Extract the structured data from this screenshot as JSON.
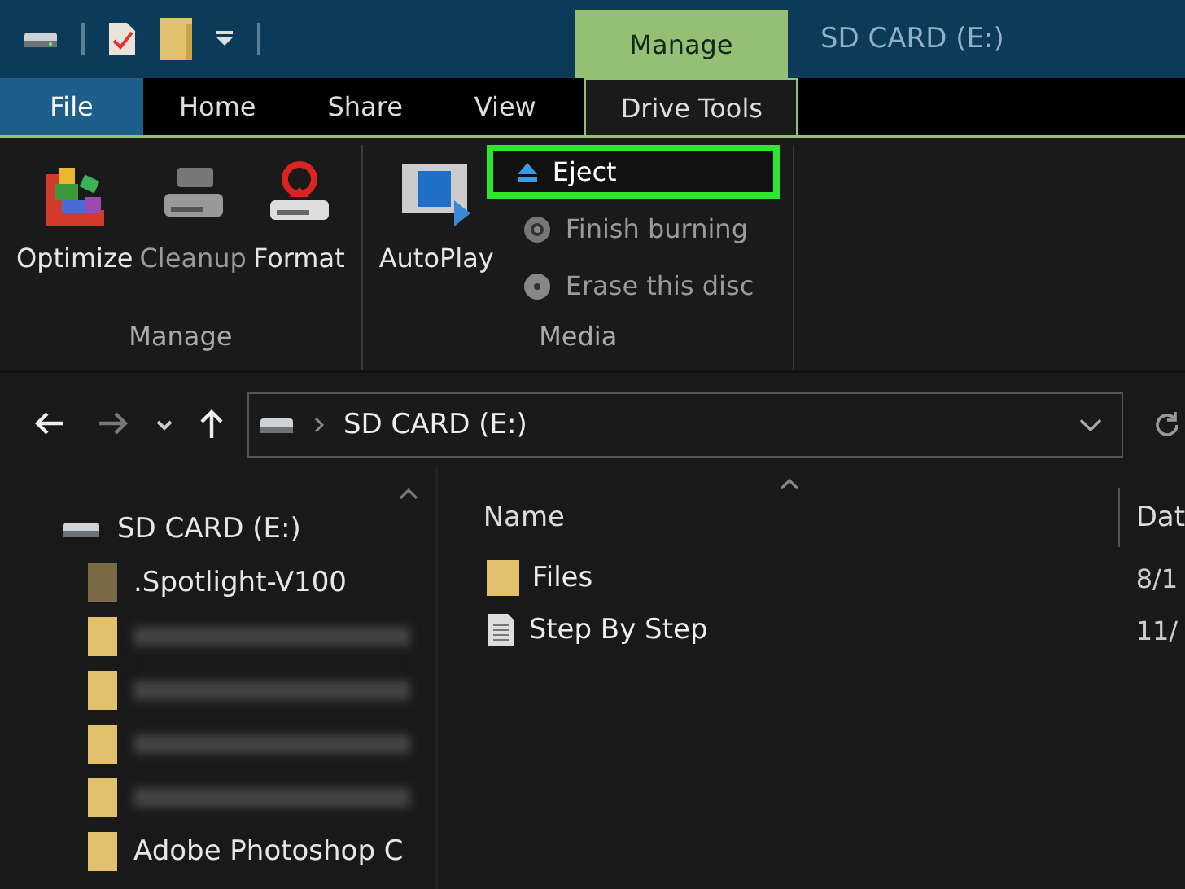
{
  "window": {
    "title": "SD CARD (E:)",
    "context_group": "Manage"
  },
  "tabs": [
    {
      "label": "File",
      "kind": "file",
      "selected": false
    },
    {
      "label": "Home",
      "kind": "tab",
      "selected": false
    },
    {
      "label": "Share",
      "kind": "tab",
      "selected": false
    },
    {
      "label": "View",
      "kind": "tab",
      "selected": false
    },
    {
      "label": "Drive Tools",
      "kind": "context",
      "selected": true
    }
  ],
  "ribbon": {
    "groups": [
      {
        "label": "Manage",
        "large_buttons": [
          {
            "label": "Optimize",
            "kind": "optimize",
            "disabled": false
          },
          {
            "label": "Cleanup",
            "kind": "cleanup",
            "disabled": true
          },
          {
            "label": "Format",
            "kind": "format",
            "disabled": false
          }
        ]
      },
      {
        "label": "Media",
        "large_buttons": [
          {
            "label": "AutoPlay",
            "kind": "autoplay",
            "disabled": false
          }
        ],
        "small_buttons": [
          {
            "label": "Eject",
            "kind": "eject",
            "disabled": false,
            "highlighted": true
          },
          {
            "label": "Finish burning",
            "kind": "burn",
            "disabled": true,
            "highlighted": false
          },
          {
            "label": "Erase this disc",
            "kind": "erase",
            "disabled": true,
            "highlighted": false
          }
        ]
      }
    ]
  },
  "navigation": {
    "back_disabled": false,
    "forward_disabled": true,
    "path": "SD CARD (E:)"
  },
  "navigation_pane": {
    "items": [
      {
        "label": "SD CARD (E:)",
        "kind": "drive"
      },
      {
        "label": ".Spotlight-V100",
        "kind": "hidden-folder"
      },
      {
        "kind": "blurred"
      },
      {
        "kind": "blurred"
      },
      {
        "kind": "blurred"
      },
      {
        "kind": "blurred"
      },
      {
        "label": "Adobe Photoshop C",
        "kind": "folder"
      }
    ]
  },
  "file_list": {
    "columns": [
      "Name",
      "Dat"
    ],
    "rows": [
      {
        "name": "Files",
        "kind": "folder",
        "column_2": "8/1"
      },
      {
        "name": "Step By Step",
        "kind": "document",
        "column_2": "11/"
      }
    ]
  }
}
